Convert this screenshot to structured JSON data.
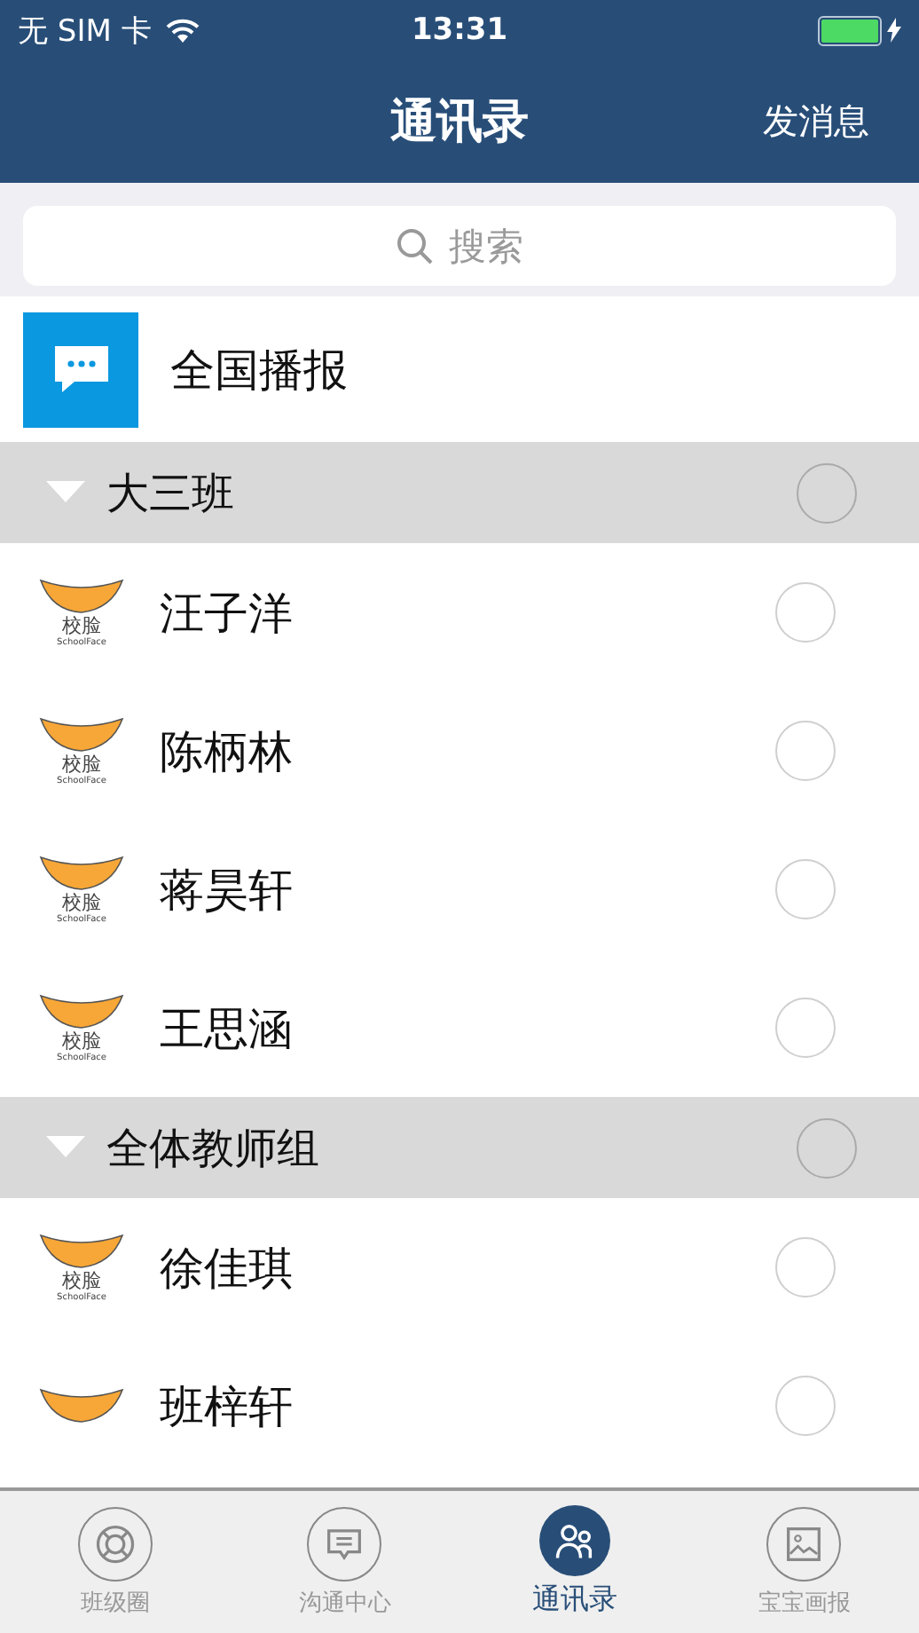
{
  "status_bar": {
    "carrier": "无 SIM 卡",
    "time": "13:31",
    "charging": true
  },
  "nav": {
    "title": "通讯录",
    "action": "发消息"
  },
  "search": {
    "placeholder": "搜索"
  },
  "broadcast": {
    "label": "全国播报"
  },
  "groups": [
    {
      "name": "大三班",
      "expanded": true,
      "checked": false,
      "members": [
        {
          "name": "汪子洋",
          "checked": false,
          "logo_text": "校脸",
          "logo_subtext": "SchoolFace"
        },
        {
          "name": "陈柄林",
          "checked": false,
          "logo_text": "校脸",
          "logo_subtext": "SchoolFace"
        },
        {
          "name": "蒋昊轩",
          "checked": false,
          "logo_text": "校脸",
          "logo_subtext": "SchoolFace"
        },
        {
          "name": "王思涵",
          "checked": false,
          "logo_text": "校脸",
          "logo_subtext": "SchoolFace"
        }
      ]
    },
    {
      "name": "全体教师组",
      "expanded": true,
      "checked": false,
      "members": [
        {
          "name": "徐佳琪",
          "checked": false,
          "logo_text": "校脸",
          "logo_subtext": "SchoolFace"
        },
        {
          "name": "班梓轩",
          "checked": false
        }
      ]
    }
  ],
  "tabs": [
    {
      "label": "班级圈",
      "kind": "ring",
      "selected": false
    },
    {
      "label": "沟通中心",
      "kind": "chat",
      "selected": false
    },
    {
      "label": "通讯录",
      "kind": "contacts",
      "selected": true
    },
    {
      "label": "宝宝画报",
      "kind": "image",
      "selected": false
    }
  ]
}
